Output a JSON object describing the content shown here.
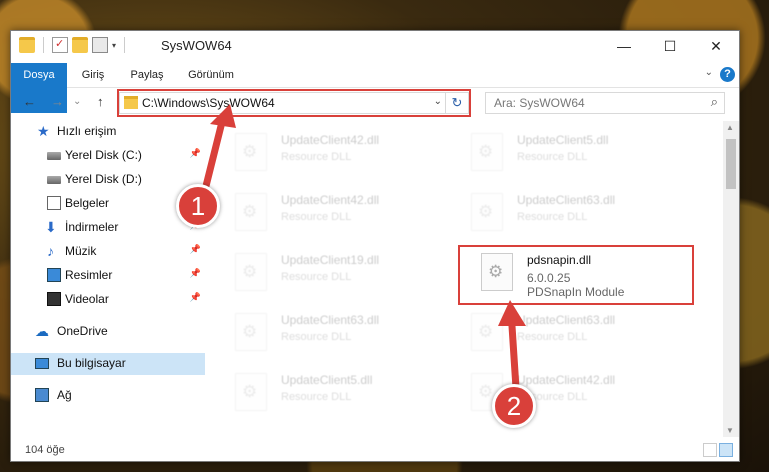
{
  "window": {
    "title": "SysWOW64",
    "controls": {
      "minimize": "—",
      "maximize": "☐",
      "close": "✕"
    }
  },
  "ribbon": {
    "tabs": [
      "Dosya",
      "Giriş",
      "Paylaş",
      "Görünüm"
    ],
    "help": "?"
  },
  "navigation": {
    "back": "←",
    "forward": "→",
    "up": "↑",
    "recent": "⌄",
    "address": "C:\\Windows\\SysWOW64",
    "search_placeholder": "Ara: SysWOW64"
  },
  "sidebar": {
    "items": [
      {
        "label": "Hızlı erişim"
      },
      {
        "label": "Yerel Disk (C:)"
      },
      {
        "label": "Yerel Disk (D:)"
      },
      {
        "label": "Belgeler"
      },
      {
        "label": "İndirmeler"
      },
      {
        "label": "Müzik"
      },
      {
        "label": "Resimler"
      },
      {
        "label": "Videolar"
      },
      {
        "label": "OneDrive"
      },
      {
        "label": "Bu bilgisayar"
      },
      {
        "label": "Ağ"
      }
    ]
  },
  "files": [
    {
      "name": "UpdateClient42.dll",
      "desc": "Resource DLL"
    },
    {
      "name": "UpdateClient5.dll",
      "desc": "Resource DLL"
    },
    {
      "name": "UpdateClient42.dll",
      "desc": "Resource DLL"
    },
    {
      "name": "UpdateClient63.dll",
      "desc": "Resource DLL"
    },
    {
      "name": "UpdateClient19.dll",
      "desc": "Resource DLL"
    },
    {
      "name": "pdsnapin.dll",
      "version": "6.0.0.25",
      "desc": "PDSnapIn Module"
    },
    {
      "name": "UpdateClient63.dll",
      "desc": "Resource DLL"
    },
    {
      "name": "UpdateClient63.dll",
      "desc": "Resource DLL"
    },
    {
      "name": "UpdateClient5.dll",
      "desc": "Resource DLL"
    },
    {
      "name": "UpdateClient42.dll",
      "desc": "Resource DLL"
    }
  ],
  "status": {
    "count": "104 öğe"
  },
  "annotations": {
    "step1": "1",
    "step2": "2",
    "color": "#d9403a"
  }
}
